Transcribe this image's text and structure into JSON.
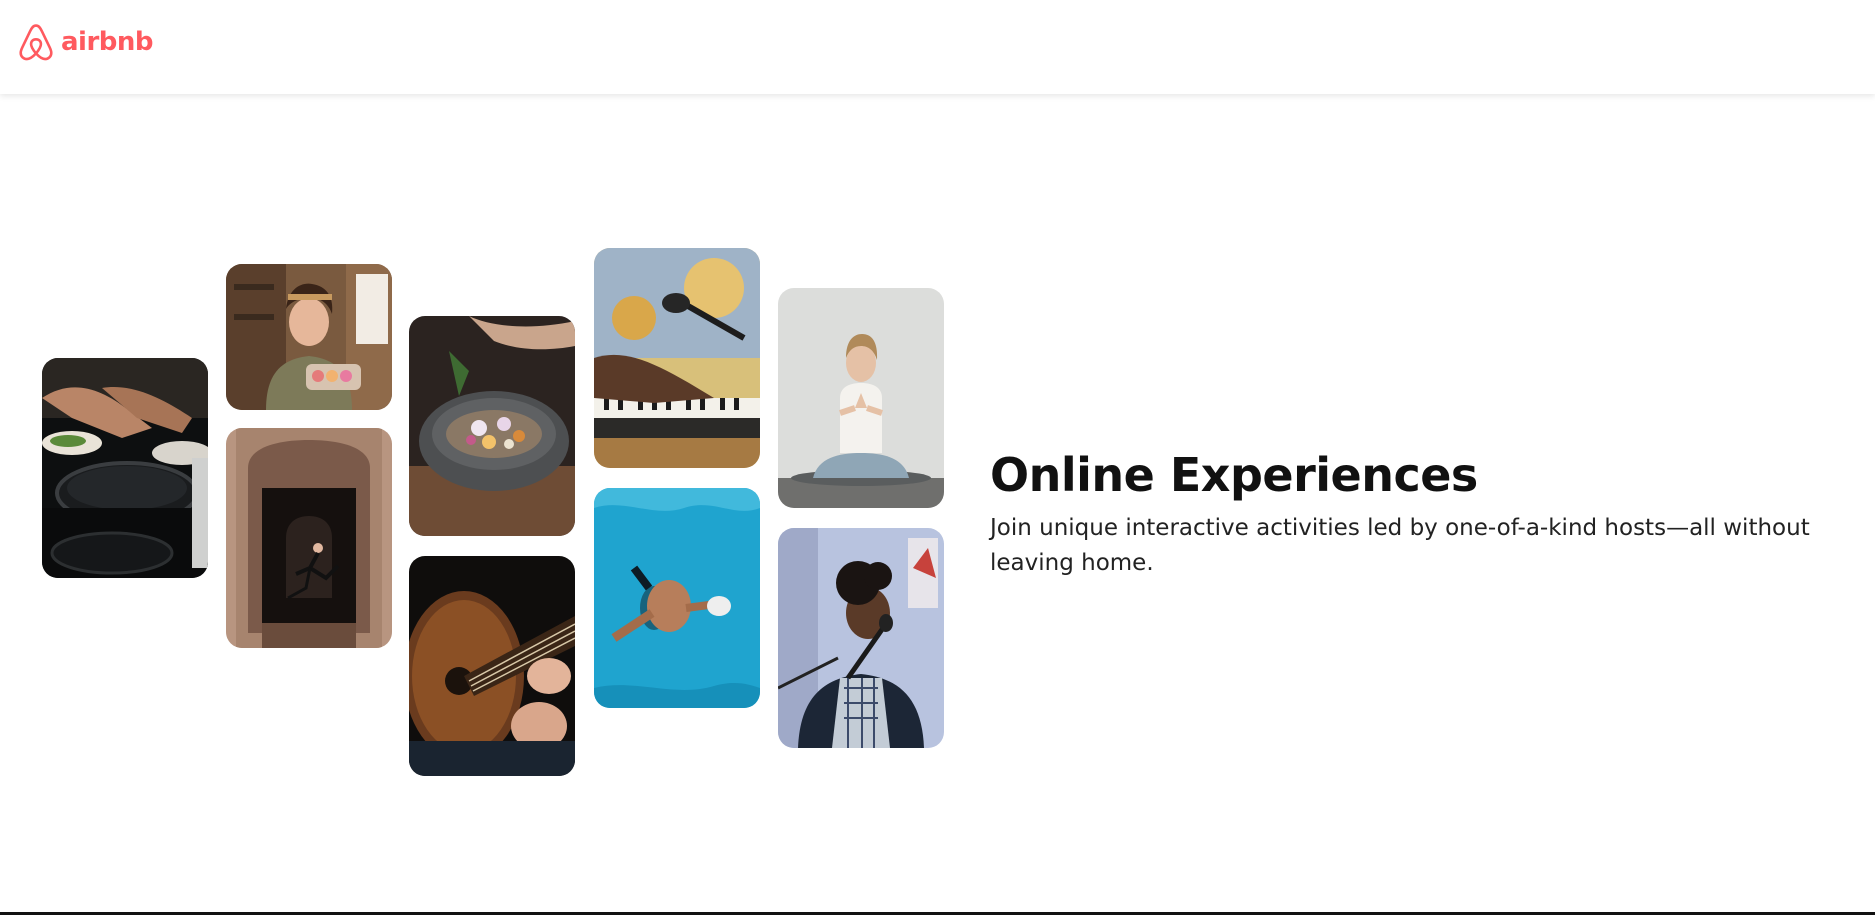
{
  "brand": {
    "name": "airbnb",
    "color": "#ff5a5f"
  },
  "hero": {
    "title": "Online Experiences",
    "subtitle": "Join unique interactive activities led by one-of-a-kind hosts—all without leaving home."
  },
  "gallery": {
    "tiles": [
      {
        "subject": "cooking-pans"
      },
      {
        "subject": "woman-holding-macarons"
      },
      {
        "subject": "dancer-in-doorway"
      },
      {
        "subject": "bowl-seasoning"
      },
      {
        "subject": "acoustic-guitar"
      },
      {
        "subject": "piano-with-microphone"
      },
      {
        "subject": "swimmer-in-pool"
      },
      {
        "subject": "yoga-meditation"
      },
      {
        "subject": "singer-with-microphone"
      }
    ]
  }
}
